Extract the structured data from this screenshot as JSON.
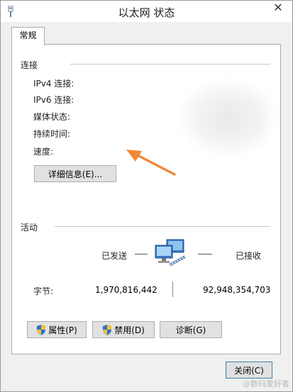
{
  "window": {
    "title": "以太网 状态",
    "close_glyph": "✕",
    "tab_label": "常规"
  },
  "connection": {
    "group_title": "连接",
    "labels": [
      "IPv4 连接:",
      "IPv6 连接:",
      "媒体状态:",
      "持续时间:",
      "速度:"
    ],
    "details_button": "详细信息(E)..."
  },
  "activity": {
    "group_title": "活动",
    "sent_label": "已发送",
    "received_label": "已接收",
    "bytes_label": "字节:",
    "bytes_sent": "1,970,816,442",
    "bytes_received": "92,948,354,703"
  },
  "buttons": {
    "properties": "属性(P)",
    "disable": "禁用(D)",
    "diagnose": "诊断(G)",
    "close": "关闭(C)"
  },
  "watermark": "@数码爱好者",
  "colors": {
    "arrow": "#f0883a",
    "shield_blue": "#2f6fd6",
    "shield_yellow": "#f2c230"
  },
  "icons": [
    "network-adapter-icon",
    "network-activity-icon",
    "shield-icon",
    "close-icon",
    "arrow-annotation"
  ]
}
